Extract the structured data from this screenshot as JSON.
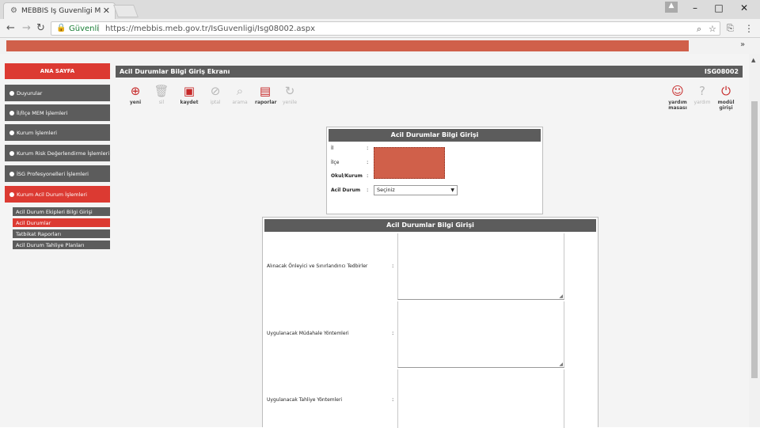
{
  "browser": {
    "tab_title": "MEBBİS İş Guvenligi Mo",
    "tab_close": "✕",
    "secure_label": "Güvenli",
    "url": "https://mebbis.meb.gov.tr/IsGuvenligi/Isg08002.aspx",
    "window_controls": [
      "–",
      "□",
      "✕"
    ]
  },
  "sidebar": {
    "home": "ANA SAYFA",
    "items": [
      {
        "label": "Duyurular"
      },
      {
        "label": "İl/İlçe MEM İşlemleri"
      },
      {
        "label": "Kurum İşlemleri"
      },
      {
        "label": "Kurum Risk Değerlendirme İşlemleri"
      },
      {
        "label": "İSG Profesyonelleri İşlemleri"
      },
      {
        "label": "Kurum Acil Durum İşlemleri"
      }
    ],
    "subitems": [
      {
        "label": "Acil Durum Ekipleri Bilgi Girişi"
      },
      {
        "label": "Acil Durumlar"
      },
      {
        "label": "Tatbikat Raporları"
      },
      {
        "label": "Acil Durum Tahliye Planları"
      }
    ]
  },
  "main": {
    "title": "Acil Durumlar Bilgi Giriş Ekranı",
    "code": "ISG08002",
    "toolbar": [
      {
        "label": "yeni",
        "icon": "plus-circle-icon",
        "glyph": "⊕",
        "enabled": true
      },
      {
        "label": "sil",
        "icon": "trash-icon",
        "glyph": "🗑",
        "enabled": false
      },
      {
        "label": "kaydet",
        "icon": "save-icon",
        "glyph": "▣",
        "enabled": true
      },
      {
        "label": "iptal",
        "icon": "cancel-icon",
        "glyph": "⊘",
        "enabled": false
      },
      {
        "label": "arama",
        "icon": "search-icon",
        "glyph": "⌕",
        "enabled": false
      },
      {
        "label": "raporlar",
        "icon": "report-icon",
        "glyph": "▤",
        "enabled": true
      },
      {
        "label": "yenile",
        "icon": "refresh-icon",
        "glyph": "↻",
        "enabled": false
      }
    ],
    "right_toolbar": [
      {
        "label": "yardım masası",
        "icon": "helpdesk-icon",
        "glyph": "☺",
        "enabled": true
      },
      {
        "label": "yardım",
        "icon": "help-icon",
        "glyph": "?",
        "enabled": false
      },
      {
        "label": "modül girişi",
        "icon": "power-icon",
        "glyph": "⏻",
        "enabled": true
      }
    ]
  },
  "form1": {
    "title": "Acil Durumlar Bilgi Girişi",
    "labels": {
      "il": "İl",
      "ilce": "İlçe",
      "okul": "Okul/Kurum",
      "acil": "Acil Durum"
    },
    "colon": ":",
    "select_value": "Seçiniz"
  },
  "form2": {
    "title": "Acil Durumlar Bilgi Girişi",
    "rows": [
      {
        "label": "Alınacak Önleyici ve Sınırlandırıcı Tedbirler"
      },
      {
        "label": "Uygulanacak Müdahale Yöntemleri"
      },
      {
        "label": "Uygulanacak Tahliye Yöntemleri"
      }
    ],
    "colon": ":"
  },
  "colors": {
    "accent": "#dc3a32",
    "header": "#5c5c5c",
    "redacted": "#d0604a"
  }
}
